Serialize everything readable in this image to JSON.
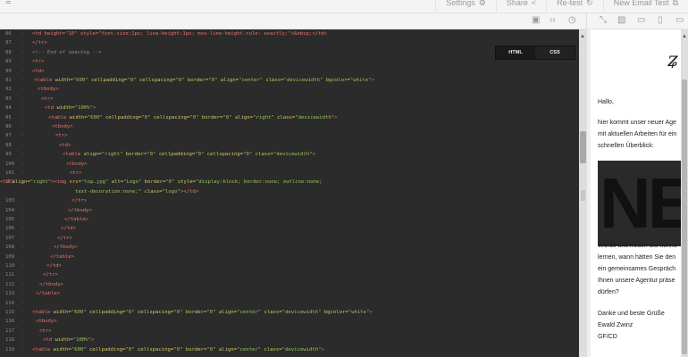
{
  "topbar": {
    "menu_icon": "hamburger-icon",
    "settings_label": "Settings",
    "share_label": "Share",
    "retest_label": "Re-test",
    "new_test_label": "New Email Test"
  },
  "editor_tabs": {
    "html": "HTML",
    "css": "CSS"
  },
  "code_lines": [
    {
      "n": "86",
      "parts": [
        [
          "t",
          "<td height=\"10\" style=\"font-size:1px; line-height:1px; mso-line-height-rule: exactly;\">&nbsp;</td>"
        ]
      ]
    },
    {
      "n": "87",
      "parts": [
        [
          "t",
          "</tr>"
        ]
      ]
    },
    {
      "n": "88",
      "parts": [
        [
          "c",
          "<!-- End of spacing -->"
        ]
      ]
    },
    {
      "n": "89",
      "parts": [
        [
          "t",
          "<tr>"
        ]
      ]
    },
    {
      "n": "90",
      "parts": [
        [
          "t",
          "<td>"
        ]
      ]
    },
    {
      "n": "91",
      "parts": [
        [
          "t",
          "<table "
        ],
        [
          "a",
          "width="
        ],
        [
          "v",
          "\"600\" "
        ],
        [
          "a",
          "cellpadding="
        ],
        [
          "v",
          "\"0\" "
        ],
        [
          "a",
          "cellspacing="
        ],
        [
          "v",
          "\"0\" "
        ],
        [
          "a",
          "border="
        ],
        [
          "v",
          "\"0\" "
        ],
        [
          "a",
          "align="
        ],
        [
          "v",
          "\"center\" "
        ],
        [
          "a",
          "class="
        ],
        [
          "v",
          "\"devicewidth\" "
        ],
        [
          "a",
          "bgcolor="
        ],
        [
          "v",
          "\"white\""
        ],
        [
          "t",
          ">"
        ]
      ]
    },
    {
      "n": "92",
      "parts": [
        [
          "t",
          "<tbody>"
        ]
      ]
    },
    {
      "n": "93",
      "parts": [
        [
          "t",
          "<tr>"
        ]
      ]
    },
    {
      "n": "94",
      "parts": [
        [
          "t",
          "<td "
        ],
        [
          "a",
          "width="
        ],
        [
          "v",
          "\"100%\""
        ],
        [
          "t",
          ">"
        ]
      ]
    },
    {
      "n": "95",
      "parts": [
        [
          "t",
          "<table "
        ],
        [
          "a",
          "width="
        ],
        [
          "v",
          "\"600\" "
        ],
        [
          "a",
          "cellpadding="
        ],
        [
          "v",
          "\"0\" "
        ],
        [
          "a",
          "cellspacing="
        ],
        [
          "v",
          "\"0\" "
        ],
        [
          "a",
          "border="
        ],
        [
          "v",
          "\"0\" "
        ],
        [
          "a",
          "align="
        ],
        [
          "v",
          "\"right\" "
        ],
        [
          "a",
          "class="
        ],
        [
          "v",
          "\"devicewidth\""
        ],
        [
          "t",
          ">"
        ]
      ]
    },
    {
      "n": "96",
      "parts": [
        [
          "t",
          "<tbody>"
        ]
      ]
    },
    {
      "n": "97",
      "parts": [
        [
          "t",
          "<tr>"
        ]
      ]
    },
    {
      "n": "98",
      "parts": [
        [
          "t",
          "<td>"
        ]
      ]
    },
    {
      "n": "99",
      "parts": [
        [
          "t",
          "<table "
        ],
        [
          "a",
          "align="
        ],
        [
          "v",
          "\"right\" "
        ],
        [
          "a",
          "border="
        ],
        [
          "v",
          "\"0\" "
        ],
        [
          "a",
          "cellpadding="
        ],
        [
          "v",
          "\"0\" "
        ],
        [
          "a",
          "cellspacing="
        ],
        [
          "v",
          "\"0\" "
        ],
        [
          "a",
          "class="
        ],
        [
          "v",
          "\"devicewidth\""
        ],
        [
          "t",
          ">"
        ]
      ]
    },
    {
      "n": "100",
      "parts": [
        [
          "t",
          "<tbody>"
        ]
      ]
    },
    {
      "n": "101",
      "parts": [
        [
          "t",
          "<tr>"
        ]
      ]
    },
    {
      "n": "102",
      "parts": [
        [
          "t",
          "<td "
        ],
        [
          "a",
          "align="
        ],
        [
          "v",
          "\"right\""
        ],
        [
          "t",
          "><img "
        ],
        [
          "a",
          "src="
        ],
        [
          "v",
          "\"top.jpg\" "
        ],
        [
          "a",
          "alt="
        ],
        [
          "v",
          "\"Logo\" "
        ],
        [
          "a",
          "border="
        ],
        [
          "v",
          "\"0\" "
        ],
        [
          "a",
          "style="
        ],
        [
          "v",
          "\"display:block; border:none; outline:none;"
        ]
      ]
    },
    {
      "n": "",
      "parts": [
        [
          "v",
          "text-decoration:none;\" "
        ],
        [
          "a",
          "class="
        ],
        [
          "v",
          "\"logo\""
        ],
        [
          "t",
          "></td>"
        ]
      ]
    },
    {
      "n": "103",
      "parts": [
        [
          "t",
          "</tr>"
        ]
      ]
    },
    {
      "n": "104",
      "parts": [
        [
          "t",
          "</tbody>"
        ]
      ]
    },
    {
      "n": "105",
      "parts": [
        [
          "t",
          "</table>"
        ]
      ]
    },
    {
      "n": "106",
      "parts": [
        [
          "t",
          "</td>"
        ]
      ]
    },
    {
      "n": "107",
      "parts": [
        [
          "t",
          "</tr>"
        ]
      ]
    },
    {
      "n": "108",
      "parts": [
        [
          "t",
          "</tbody>"
        ]
      ]
    },
    {
      "n": "109",
      "parts": [
        [
          "t",
          "</table>"
        ]
      ]
    },
    {
      "n": "110",
      "parts": [
        [
          "t",
          "</td>"
        ]
      ]
    },
    {
      "n": "111",
      "parts": [
        [
          "t",
          "</tr>"
        ]
      ]
    },
    {
      "n": "112",
      "parts": [
        [
          "t",
          "</tbody>"
        ]
      ]
    },
    {
      "n": "113",
      "parts": [
        [
          "t",
          "</table>"
        ]
      ]
    },
    {
      "n": "114",
      "parts": []
    },
    {
      "n": "115",
      "parts": [
        [
          "t",
          "<table "
        ],
        [
          "a",
          "width="
        ],
        [
          "v",
          "\"600\" "
        ],
        [
          "a",
          "cellpadding="
        ],
        [
          "v",
          "\"0\" "
        ],
        [
          "a",
          "cellspacing="
        ],
        [
          "v",
          "\"0\" "
        ],
        [
          "a",
          "border="
        ],
        [
          "v",
          "\"0\" "
        ],
        [
          "a",
          "align="
        ],
        [
          "v",
          "\"center\" "
        ],
        [
          "a",
          "class="
        ],
        [
          "v",
          "\"devicewidth\" "
        ],
        [
          "a",
          "bgcolor="
        ],
        [
          "v",
          "\"white\""
        ],
        [
          "t",
          ">"
        ]
      ]
    },
    {
      "n": "116",
      "parts": [
        [
          "t",
          "<tbody>"
        ]
      ]
    },
    {
      "n": "117",
      "parts": [
        [
          "t",
          "<tr>"
        ]
      ]
    },
    {
      "n": "118",
      "parts": [
        [
          "t",
          "<td "
        ],
        [
          "a",
          "width="
        ],
        [
          "v",
          "\"100%\""
        ],
        [
          "t",
          ">"
        ]
      ]
    },
    {
      "n": "119",
      "parts": [
        [
          "t",
          "<table "
        ],
        [
          "a",
          "width="
        ],
        [
          "v",
          "\"600\" "
        ],
        [
          "a",
          "cellpadding="
        ],
        [
          "v",
          "\"0\" "
        ],
        [
          "a",
          "cellspacing="
        ],
        [
          "v",
          "\"0\" "
        ],
        [
          "a",
          "border="
        ],
        [
          "v",
          "\"0\" "
        ],
        [
          "a",
          "align="
        ],
        [
          "v",
          "\"center\" "
        ],
        [
          "a",
          "class="
        ],
        [
          "v",
          "\"devicewidth\""
        ],
        [
          "t",
          ">"
        ]
      ]
    }
  ],
  "preview": {
    "greeting": "Hallo,",
    "intro_1": "hier kommt unser neuer Age",
    "intro_2": "mit aktuellen Arbeiten für ein",
    "intro_3": "schnellen Überblick:",
    "banner_text": "NEW",
    "body_1": "Würde uns freuen Sie kenne",
    "body_2": "lernen, wann hätten Sie den",
    "body_3": "ein gemeinsames Gespräch",
    "body_4": "Ihnen unsere Agentur präse",
    "body_5": "dürfen?",
    "closing": "Danke und beste Grüße",
    "name": "Ewald Zwinz",
    "company": "GF/CD"
  }
}
